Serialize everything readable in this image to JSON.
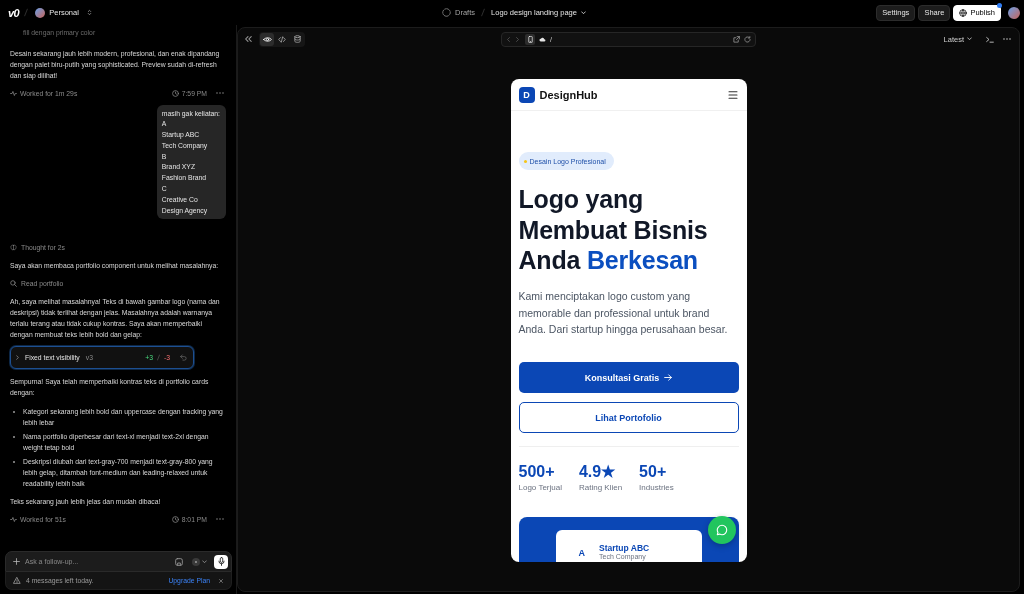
{
  "top_bar": {
    "logo": "v0",
    "workspace": "Personal",
    "breadcrumb": [
      {
        "kind": "drafts",
        "label": "Drafts"
      },
      {
        "kind": "project",
        "label": "Logo design landing page"
      }
    ],
    "buttons": [
      {
        "kind": "settings",
        "label": "Settings",
        "notification": false
      },
      {
        "kind": "share",
        "label": "Share",
        "notification": false
      },
      {
        "kind": "publish",
        "label": "Publish",
        "notification": true
      }
    ]
  },
  "chat": {
    "messages": [
      {
        "kind": "faded",
        "text": "fill dengan primary color"
      },
      {
        "kind": "text",
        "text": "Desain sekarang jauh lebih modern, profesional, dan enak dipandang dengan palet biru-putih yang sophisticated. Preview sudah di-refresh dan siap dilihat!"
      },
      {
        "kind": "meta",
        "label": "Worked for 1m 29s",
        "time": "7:59 PM"
      },
      {
        "kind": "user",
        "text": "masih gak keliatan:\nA\nStartup ABC\nTech Company\nB\nBrand XYZ\nFashion Brand\nC\nCreative Co\nDesign Agency"
      },
      {
        "kind": "thought",
        "label": "Thought for 2s"
      },
      {
        "kind": "text",
        "text": "Saya akan membaca portfolio component untuk melihat masalahnya:"
      },
      {
        "kind": "tool",
        "label": "Read portfolio"
      },
      {
        "kind": "text",
        "text": "Ah, saya melihat masalahnya! Teks di bawah gambar logo (nama dan deskripsi) tidak terlihat dengan jelas. Masalahnya adalah warnanya terlalu terang atau tidak cukup kontras. Saya akan memperbaiki dengan membuat teks lebih bold dan gelap:"
      },
      {
        "kind": "version",
        "title": "Fixed text visibility",
        "version": "v3",
        "added": "+3",
        "removed": "-3",
        "selected": true
      },
      {
        "kind": "text",
        "text": "Sempurna! Saya telah memperbaiki kontras teks di portfolio cards dengan:"
      },
      {
        "kind": "list",
        "items": [
          "Kategori sekarang lebih bold dan uppercase dengan tracking yang lebih lebar",
          "Nama portfolio diperbesar dari text-xl menjadi text-2xl dengan weight tetap bold",
          "Deskripsi diubah dari text-gray-700 menjadi text-gray-800 yang lebih gelap, ditambah font-medium dan leading-relaxed untuk readability lebih baik"
        ]
      },
      {
        "kind": "text",
        "text": "Teks sekarang jauh lebih jelas dan mudah dibaca!"
      },
      {
        "kind": "meta",
        "label": "Worked for 51s",
        "time": "8:01 PM"
      }
    ]
  },
  "composer": {
    "placeholder": "Ask a follow-up...",
    "notice": "4 messages left today.",
    "link": "Upgrade Plan"
  },
  "preview_toolbar": {
    "views": [
      {
        "kind": "preview",
        "selected": true
      },
      {
        "kind": "code",
        "selected": false
      },
      {
        "kind": "database",
        "selected": false
      }
    ],
    "mobile_view": true,
    "url": "/",
    "version": "Latest"
  },
  "site": {
    "logo_letter": "D",
    "brand": "DesignHub",
    "badge": "Desain Logo Profesional",
    "headline": "Logo yang Membuat Bisnis Anda",
    "headline_highlight": "Berkesan",
    "description": "Kami menciptakan logo custom yang memorable dan professional untuk brand Anda. Dari startup hingga perusahaan besar.",
    "primary_button": "Konsultasi Gratis",
    "secondary_button": "Lihat Portofolio",
    "stats": [
      {
        "value": "500+",
        "label": "Logo Terjual"
      },
      {
        "value": "4.9★",
        "label": "Rating Klien"
      },
      {
        "value": "50+",
        "label": "Industries"
      }
    ],
    "portfolio": {
      "letter": "A",
      "name": "Startup ABC",
      "category": "Tech Company"
    }
  }
}
